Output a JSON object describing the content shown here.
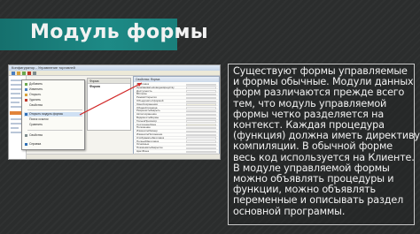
{
  "slide": {
    "title": "Модуль формы",
    "body_lines": [
      "Существуют формы управляемые",
      "и формы обычные. Модули данных",
      "форм различаются прежде всего",
      "тем, что модуль управляемой",
      "формы четко разделяется на",
      "контекст. Каждая процедура",
      "(функция) должна иметь директиву",
      "компиляции. В обычной форме",
      "весь код используется на Клиенте.",
      "В модуле управляемой формы",
      "можно объявлять процедуры и",
      "функции, можно объявлять",
      "переменные и описывать раздел",
      "основной программы."
    ]
  },
  "screenshot": {
    "window_title": "Конфигуратор - Управление торговлей",
    "context_menu_items": [
      "Добавить",
      "Изменить",
      "Открыть",
      "Удалить",
      "Свойства",
      "",
      "Открыть модуль формы",
      "Поиск ссылок",
      "Сравнить",
      "",
      "Свойства",
      "Справка"
    ],
    "mid_panel_label": "Форма",
    "mid_panel_tab": "Форма",
    "properties_title": "Свойства: Форма",
    "property_names": [
      "Заголовок",
      "ПрисваиватьНоводновредству",
      "Доступность",
      "ВСписке",
      "РежимОткрытия",
      "ОбъединятьСформой",
      "ОкноСохранения",
      "ОбщаяСтраница",
      "РазрешитьЗакрыть",
      "Автосохранение",
      "ВидимостьФормы",
      "ТолькоПросмотр",
      "СостояниеОкна",
      "Положение",
      "ИзменятьРазмер",
      "ИзменятьПоложение",
      "ОтображатьЗаголовок",
      "ПолныйЗаголовок",
      "Основные",
      "ПоказыватьЗакрытие",
      "ЦветФона",
      "РежимРабочего",
      "Шрифт"
    ],
    "colors": {
      "title_band": "#1a7f7b",
      "background": "#2b2d2d",
      "arrow": "#d22a2a",
      "highlight": "#e2843a"
    }
  }
}
